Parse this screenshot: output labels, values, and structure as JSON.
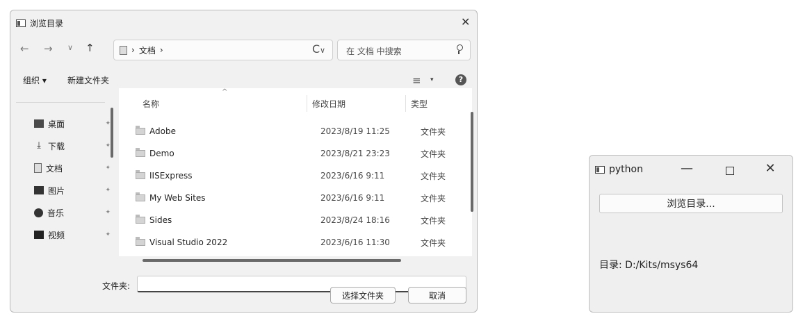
{
  "dialog": {
    "title": "浏览目录",
    "close_glyph": "✕",
    "nav": {
      "back_glyph": "←",
      "forward_glyph": "→",
      "dropdown_glyph": "∨",
      "up_glyph": "↑"
    },
    "address": {
      "separator": "›",
      "folder": "文档",
      "trailing": "›",
      "chevron": "∨"
    },
    "refresh_glyph": "C",
    "search_placeholder": "在 文档 中搜索",
    "toolbar": {
      "organize": "组织 ▾",
      "new_folder": "新建文件夹",
      "view_glyph": "≡",
      "view_dropdown": "▾",
      "help_glyph": "?"
    },
    "sidebar": [
      {
        "label": "桌面",
        "icon": "desktop-icon"
      },
      {
        "label": "下载",
        "icon": "download-icon"
      },
      {
        "label": "文档",
        "icon": "documents-icon"
      },
      {
        "label": "图片",
        "icon": "pictures-icon"
      },
      {
        "label": "音乐",
        "icon": "music-icon"
      },
      {
        "label": "视频",
        "icon": "videos-icon"
      }
    ],
    "pin_glyph": "✦",
    "columns": {
      "name": "名称",
      "modified": "修改日期",
      "type": "类型",
      "sort_glyph": "^"
    },
    "files": [
      {
        "name": "Adobe",
        "date": "2023/8/19 11:25",
        "type": "文件夹"
      },
      {
        "name": "Demo",
        "date": "2023/8/21 23:23",
        "type": "文件夹"
      },
      {
        "name": "IISExpress",
        "date": "2023/6/16 9:11",
        "type": "文件夹"
      },
      {
        "name": "My Web Sites",
        "date": "2023/6/16 9:11",
        "type": "文件夹"
      },
      {
        "name": "Sides",
        "date": "2023/8/24 18:16",
        "type": "文件夹"
      },
      {
        "name": "Visual Studio 2022",
        "date": "2023/6/16 11:30",
        "type": "文件夹"
      }
    ],
    "folder_label": "文件夹:",
    "folder_value": "",
    "select_button": "选择文件夹",
    "cancel_button": "取消"
  },
  "python_window": {
    "title": "python",
    "minimize_glyph": "—",
    "close_glyph": "✕",
    "browse_button": "浏览目录...",
    "directory_label": "目录:  D:/Kits/msys64"
  }
}
